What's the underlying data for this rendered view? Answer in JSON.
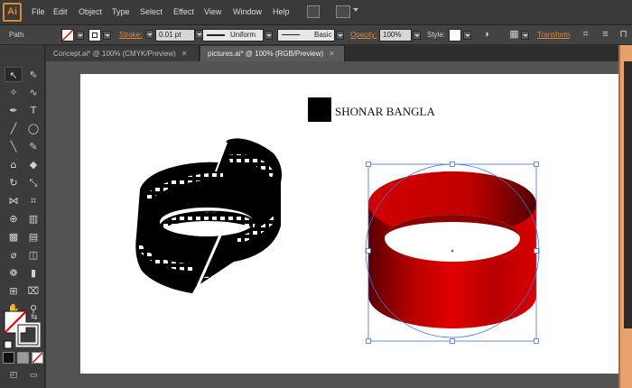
{
  "app": {
    "logo_text": "Ai"
  },
  "menu": {
    "items": [
      "File",
      "Edit",
      "Object",
      "Type",
      "Select",
      "Effect",
      "View",
      "Window",
      "Help"
    ]
  },
  "control_bar": {
    "selection_type": "Path",
    "stroke_label": "Stroke:",
    "stroke_weight": "0.01 pt",
    "profile": "Uniform",
    "brush": "Basic",
    "opacity_label": "Opacity:",
    "opacity_value": "100%",
    "style_label": "Style:",
    "transform_label": "Transform"
  },
  "tabs": [
    {
      "label": "Concept.ai* @ 100% (CMYK/Preview)",
      "active": false
    },
    {
      "label": "pictures.ai* @ 100% (RGB/Preview)",
      "active": true
    }
  ],
  "artboard": {
    "title": "SHONAR BANGLA"
  },
  "tools": [
    "selection-tool",
    "direct-selection-tool",
    "magic-wand-tool",
    "lasso-tool",
    "pen-tool",
    "type-tool",
    "line-segment-tool",
    "ellipse-tool",
    "paintbrush-tool",
    "pencil-tool",
    "blob-brush-tool",
    "eraser-tool",
    "rotate-tool",
    "scale-tool",
    "width-tool",
    "free-transform-tool",
    "shape-builder-tool",
    "perspective-grid-tool",
    "mesh-tool",
    "gradient-tool",
    "eyedropper-tool",
    "blend-tool",
    "symbol-sprayer-tool",
    "column-graph-tool",
    "artboard-tool",
    "slice-tool",
    "hand-tool",
    "zoom-tool"
  ],
  "colors": {
    "accent": "#e2862a",
    "ring_dark": "#5a0000",
    "ring_bright": "#d80000",
    "selection": "#4a6fd0"
  }
}
